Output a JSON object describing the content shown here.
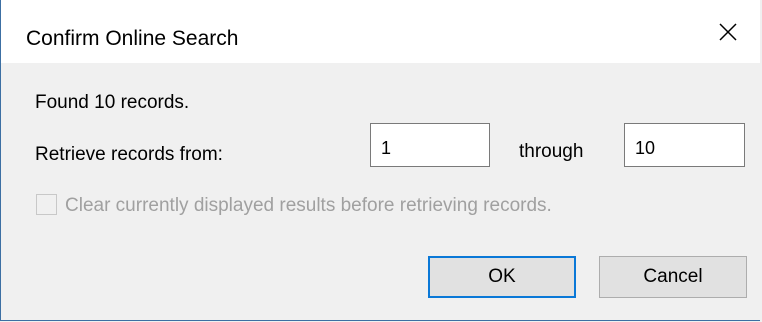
{
  "window": {
    "title": "Confirm Online Search"
  },
  "message": {
    "found": "Found 10 records."
  },
  "range": {
    "label": "Retrieve records from:",
    "from_value": "1",
    "through_label": "through",
    "to_value": "10"
  },
  "options": {
    "clear_label": "Clear currently displayed results before retrieving records.",
    "clear_checked": false,
    "clear_enabled": false
  },
  "buttons": {
    "ok_label": "OK",
    "cancel_label": "Cancel"
  },
  "colors": {
    "accent": "#0a78d7",
    "window_border": "#3c6fa3",
    "disabled_text": "#a0a0a0"
  },
  "icons": {
    "close": "close-icon"
  }
}
